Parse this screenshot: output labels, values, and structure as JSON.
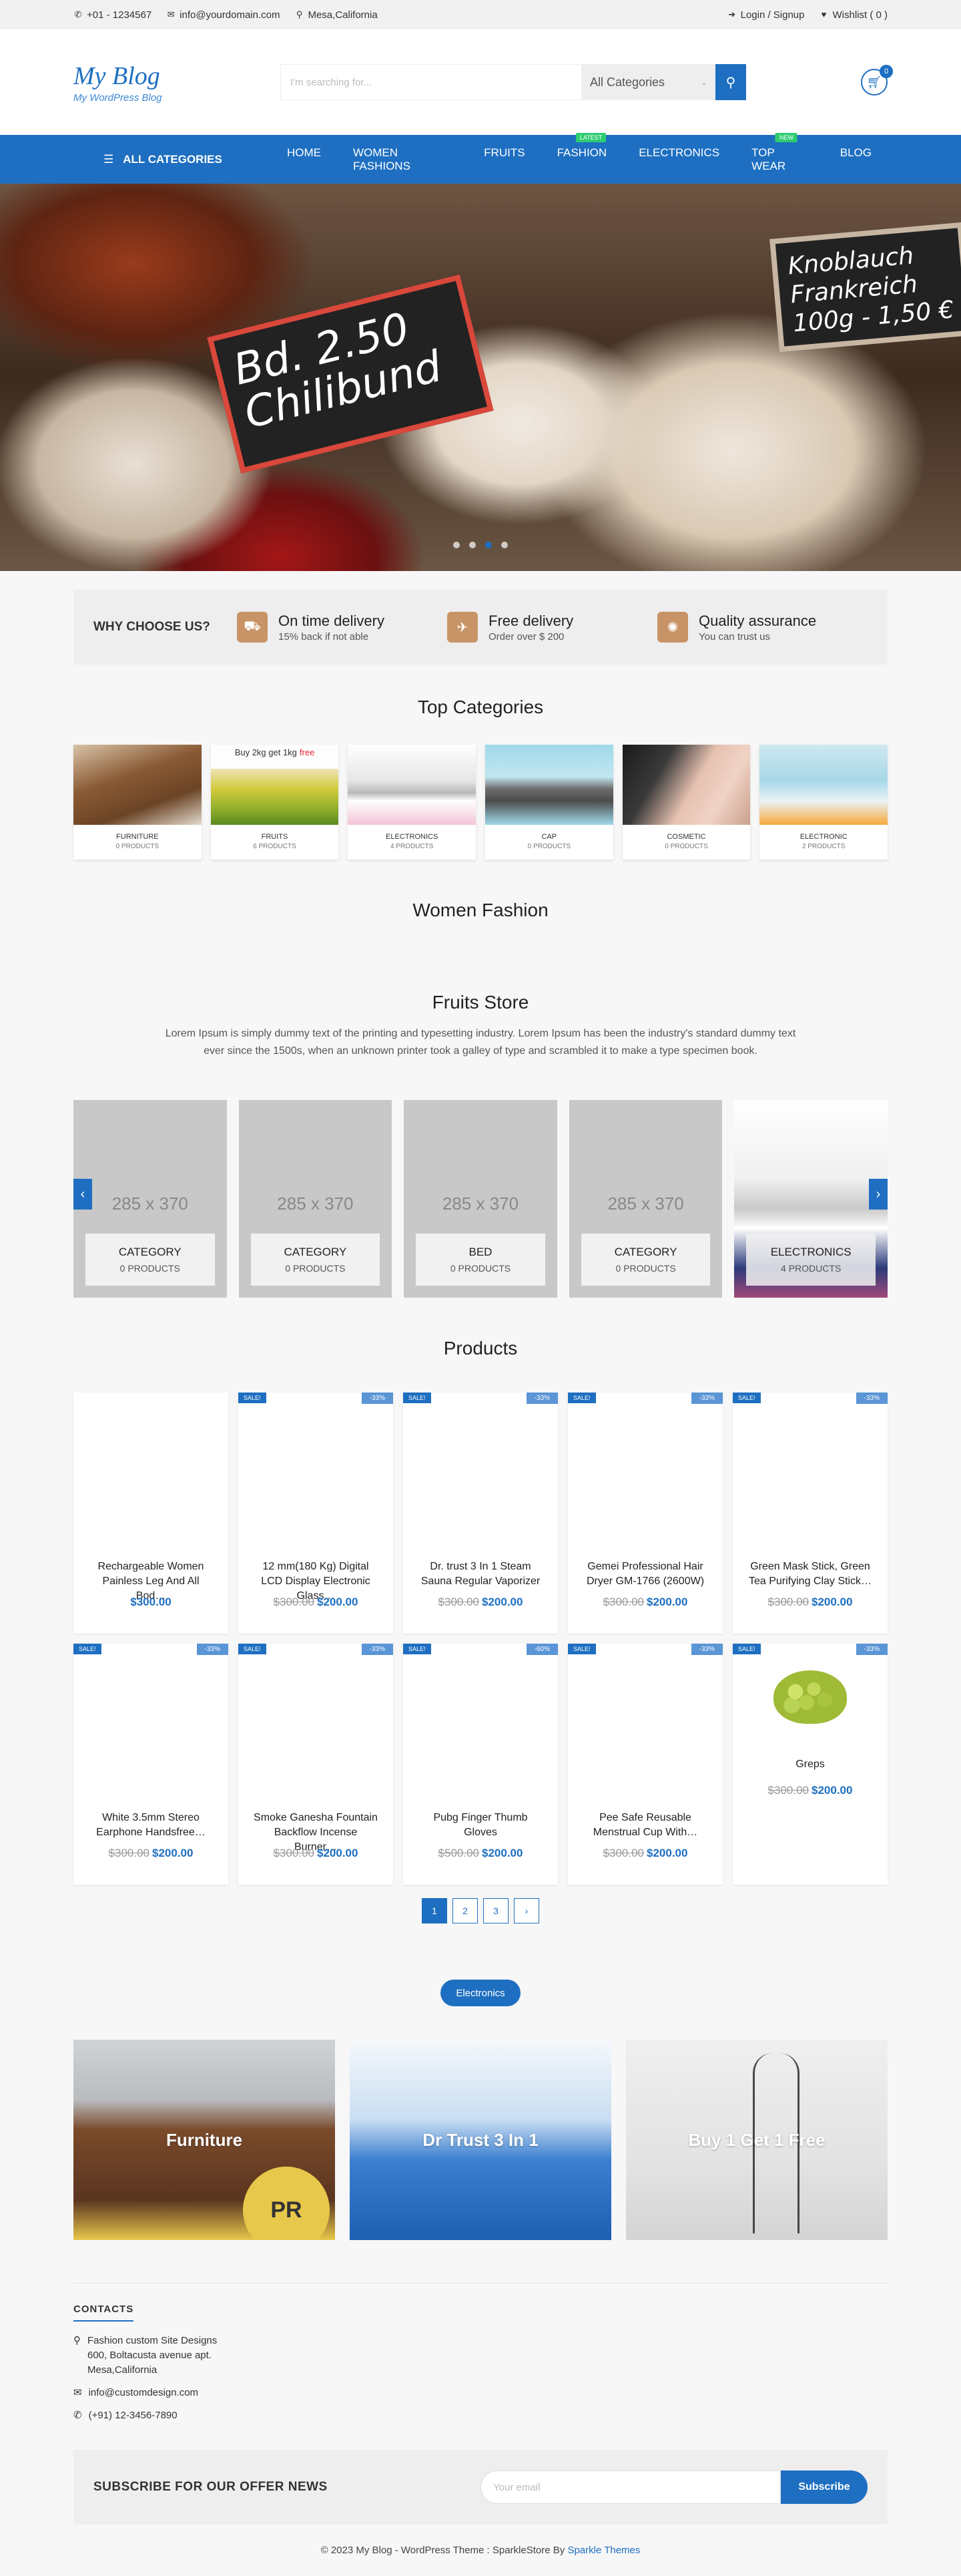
{
  "topbar": {
    "phone": "+01 - 1234567",
    "email": "info@yourdomain.com",
    "location": "Mesa,California",
    "login": "Login / Signup",
    "wishlist": "Wishlist ( 0 )"
  },
  "header": {
    "site_title": "My Blog",
    "tagline": "My WordPress Blog",
    "search_placeholder": "I'm searching for...",
    "category_select": "All Categories",
    "cart_count": "0"
  },
  "nav": {
    "all_categories": "ALL CATEGORIES",
    "links": [
      {
        "label": "HOME",
        "tag": ""
      },
      {
        "label": "WOMEN FASHIONS",
        "tag": ""
      },
      {
        "label": "FRUITS",
        "tag": ""
      },
      {
        "label": "FASHION",
        "tag": "LATEST"
      },
      {
        "label": "ELECTRONICS",
        "tag": ""
      },
      {
        "label": "TOP WEAR",
        "tag": "NEW"
      },
      {
        "label": "BLOG",
        "tag": ""
      }
    ]
  },
  "hero": {
    "sign1": "Bd. 2.50 Chilibund",
    "sign2": "Knoblauch Frankreich 100g - 1,50 €",
    "slides": 4,
    "active_slide": 3
  },
  "why": {
    "heading": "WHY CHOOSE US?",
    "features": [
      {
        "icon": "truck-icon",
        "title": "On time delivery",
        "sub": "15% back if not able"
      },
      {
        "icon": "plane-icon",
        "title": "Free delivery",
        "sub": "Order over $ 200"
      },
      {
        "icon": "badge-icon",
        "title": "Quality assurance",
        "sub": "You can trust us"
      }
    ]
  },
  "top_categories": {
    "title": "Top Categories",
    "items": [
      {
        "name": "FURNITURE",
        "count": "0 PRODUCTS"
      },
      {
        "name": "FRUITS",
        "count": "6 PRODUCTS"
      },
      {
        "name": "ELECTRONICS",
        "count": "4 PRODUCTS"
      },
      {
        "name": "CAP",
        "count": "0 PRODUCTS"
      },
      {
        "name": "COSMETIC",
        "count": "0 PRODUCTS"
      },
      {
        "name": "ELECTRONIC",
        "count": "2 PRODUCTS"
      }
    ],
    "fruits_promo": "Buy 2kg get 1kg",
    "fruits_promo_free": "free"
  },
  "women_fashion": {
    "title": "Women Fashion"
  },
  "fruits_store": {
    "title": "Fruits Store",
    "description": "Lorem Ipsum is simply dummy text of the printing and typesetting industry. Lorem Ipsum has been the industry's standard dummy text ever since the 1500s, when an unknown printer took a galley of type and scrambled it to make a type specimen book.",
    "slides": [
      {
        "placeholder": "285 x 370",
        "name": "CATEGORY",
        "count": "0 PRODUCTS"
      },
      {
        "placeholder": "285 x 370",
        "name": "CATEGORY",
        "count": "0 PRODUCTS"
      },
      {
        "placeholder": "285 x 370",
        "name": "BED",
        "count": "0 PRODUCTS"
      },
      {
        "placeholder": "285 x 370",
        "name": "CATEGORY",
        "count": "0 PRODUCTS"
      },
      {
        "placeholder": "",
        "name": "ELECTRONICS",
        "count": "4 PRODUCTS"
      }
    ]
  },
  "products": {
    "title": "Products",
    "items": [
      {
        "name": "Rechargeable Women Painless Leg And All Bod…",
        "old": "",
        "price": "$300.00",
        "sale": "",
        "off": ""
      },
      {
        "name": "12 mm(180 Kg) Digital LCD Display Electronic Glass…",
        "old": "$300.00",
        "price": "$200.00",
        "sale": "SALE!",
        "off": "-33%"
      },
      {
        "name": "Dr. trust 3 In 1 Steam Sauna Regular Vaporizer",
        "old": "$300.00",
        "price": "$200.00",
        "sale": "SALE!",
        "off": "-33%"
      },
      {
        "name": "Gemei Professional Hair Dryer GM-1766 (2600W)",
        "old": "$300.00",
        "price": "$200.00",
        "sale": "SALE!",
        "off": "-33%"
      },
      {
        "name": "Green Mask Stick, Green Tea Purifying Clay Stick…",
        "old": "$300.00",
        "price": "$200.00",
        "sale": "SALE!",
        "off": "-33%"
      },
      {
        "name": "White 3.5mm Stereo Earphone Handsfree…",
        "old": "$300.00",
        "price": "$200.00",
        "sale": "SALE!",
        "off": "-33%"
      },
      {
        "name": "Smoke Ganesha Fountain Backflow Incense Burner…",
        "old": "$300.00",
        "price": "$200.00",
        "sale": "SALE!",
        "off": "-33%"
      },
      {
        "name": "Pubg Finger Thumb Gloves",
        "old": "$500.00",
        "price": "$200.00",
        "sale": "SALE!",
        "off": "-60%"
      },
      {
        "name": "Pee Safe Reusable Menstrual Cup With…",
        "old": "$300.00",
        "price": "$200.00",
        "sale": "SALE!",
        "off": "-33%"
      },
      {
        "name": "Greps",
        "old": "$300.00",
        "price": "$200.00",
        "sale": "SALE!",
        "off": "-33%"
      }
    ],
    "pages": [
      "1",
      "2",
      "3",
      "›"
    ]
  },
  "electronics_pill": "Electronics",
  "banners": [
    "Furniture",
    "Dr Trust 3 In 1",
    "Buy 1 Get 1 Free"
  ],
  "banner_stamp": "PR",
  "footer": {
    "contacts_heading": "CONTACTS",
    "address1": "Fashion custom Site Designs",
    "address2": "600, Boltacusta avenue apt.",
    "address3": "Mesa,California",
    "email": "info@customdesign.com",
    "phone": "(+91) 12-3456-7890",
    "subscribe_heading": "SUBSCRIBE FOR OUR OFFER NEWS",
    "email_placeholder": "Your email",
    "subscribe_button": "Subscribe",
    "copyright": "© 2023 My Blog - WordPress Theme : SparkleStore By",
    "copyright_link": "Sparkle Themes"
  },
  "colors": {
    "primary": "#1e6fc1",
    "accent_icon": "#c89467",
    "tag_green": "#2ecc71"
  }
}
